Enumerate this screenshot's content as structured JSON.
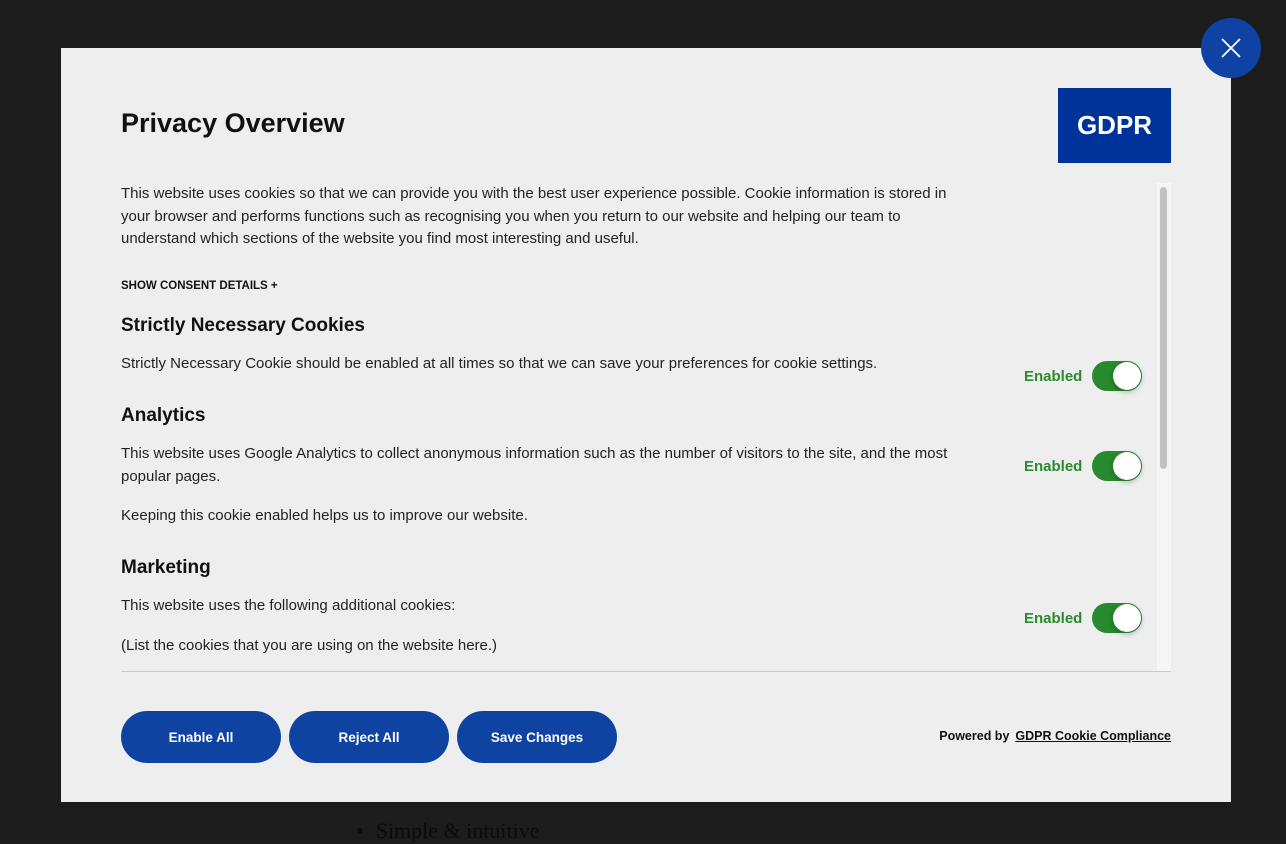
{
  "background": {
    "list_item": "Simple & intuitive"
  },
  "modal": {
    "title": "Privacy Overview",
    "logo_text": "GDPR",
    "intro": "This website uses cookies so that we can provide you with the best user experience possible. Cookie information is stored in your browser and performs functions such as recognising you when you return to our website and helping our team to understand which sections of the website you find most interesting and useful.",
    "show_details": "SHOW CONSENT DETAILS +",
    "sections": [
      {
        "title": "Strictly Necessary Cookies",
        "text": "Strictly Necessary Cookie should be enabled at all times so that we can save your preferences for cookie settings.",
        "status": "Enabled"
      },
      {
        "title": "Analytics",
        "text": "This website uses Google Analytics to collect anonymous information such as the number of visitors to the site, and the most popular pages.",
        "text2": "Keeping this cookie enabled helps us to improve our website.",
        "status": "Enabled"
      },
      {
        "title": "Marketing",
        "text": "This website uses the following additional cookies:",
        "text2": "(List the cookies that you are using on the website here.)",
        "status": "Enabled"
      }
    ],
    "buttons": {
      "enable_all": "Enable All",
      "reject_all": "Reject All",
      "save": "Save Changes"
    },
    "powered_by": "Powered by",
    "powered_link": "GDPR Cookie Compliance"
  }
}
